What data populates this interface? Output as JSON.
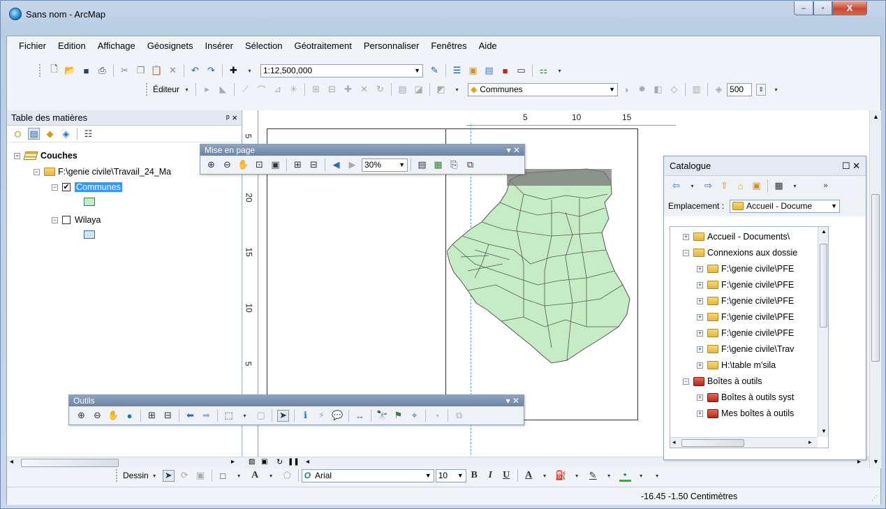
{
  "window": {
    "title": "Sans nom - ArcMap",
    "controls": {
      "minimize": "–",
      "maximize": "▫",
      "close": "X"
    }
  },
  "menu": [
    "Fichier",
    "Edition",
    "Affichage",
    "Géosignets",
    "Insérer",
    "Sélection",
    "Géotraitement",
    "Personnaliser",
    "Fenêtres",
    "Aide"
  ],
  "standard_toolbar": {
    "scale": "1:12,500,000"
  },
  "editor_toolbar": {
    "editor_label": "Éditeur",
    "layer_combo": "Communes",
    "value": "500"
  },
  "toc": {
    "title": "Table des matières",
    "pin": "ᵖ ×",
    "root": "Couches",
    "dataframe_path": "F:\\genie civile\\Travail_24_Ma",
    "layers": [
      {
        "name": "Communes",
        "checked": true,
        "selected": true,
        "swatch": "#c6ecc6"
      },
      {
        "name": "Wilaya",
        "checked": false,
        "selected": false,
        "swatch": "#cfe6f5"
      }
    ]
  },
  "layout_toolbar": {
    "title": "Mise en page",
    "zoom": "30%"
  },
  "tools_toolbar": {
    "title": "Outils"
  },
  "rulers": {
    "horizontal": [
      "5",
      "10",
      "15"
    ],
    "vertical": [
      "5",
      "20",
      "15",
      "10",
      "5"
    ]
  },
  "catalogue": {
    "title": "Catalogue",
    "location_label": "Emplacement :",
    "location_value": "Accueil - Docume",
    "items": [
      {
        "label": "Accueil - Documents\\",
        "level": 0,
        "type": "home",
        "expander": "+"
      },
      {
        "label": "Connexions aux dossie",
        "level": 0,
        "type": "folder",
        "expander": "−"
      },
      {
        "label": "F:\\genie civile\\PFE",
        "level": 1,
        "type": "folder",
        "expander": "+"
      },
      {
        "label": "F:\\genie civile\\PFE",
        "level": 1,
        "type": "folder",
        "expander": "+"
      },
      {
        "label": "F:\\genie civile\\PFE",
        "level": 1,
        "type": "folder",
        "expander": "+"
      },
      {
        "label": "F:\\genie civile\\PFE",
        "level": 1,
        "type": "folder",
        "expander": "+"
      },
      {
        "label": "F:\\genie civile\\PFE",
        "level": 1,
        "type": "folder",
        "expander": "+"
      },
      {
        "label": "F:\\genie civile\\Trav",
        "level": 1,
        "type": "folder",
        "expander": "+"
      },
      {
        "label": "H:\\table m'sila",
        "level": 1,
        "type": "folder",
        "expander": "+"
      },
      {
        "label": "Boîtes à outils",
        "level": 0,
        "type": "toolbox",
        "expander": "−"
      },
      {
        "label": "Boîtes à outils syst",
        "level": 1,
        "type": "toolbox",
        "expander": "+"
      },
      {
        "label": "Mes boîtes à outils",
        "level": 1,
        "type": "toolbox",
        "expander": "+"
      }
    ]
  },
  "drawing_toolbar": {
    "label": "Dessin",
    "font": "Arial",
    "size": "10",
    "bold": "B",
    "italic": "I",
    "underline": "U",
    "font_color": "A"
  },
  "status": {
    "coordinates": "-16.45  -1.50 Centimètres"
  },
  "colors": {
    "map_fill": "#c6ecc6",
    "map_stroke": "#555555",
    "selection": "#3399ff"
  }
}
